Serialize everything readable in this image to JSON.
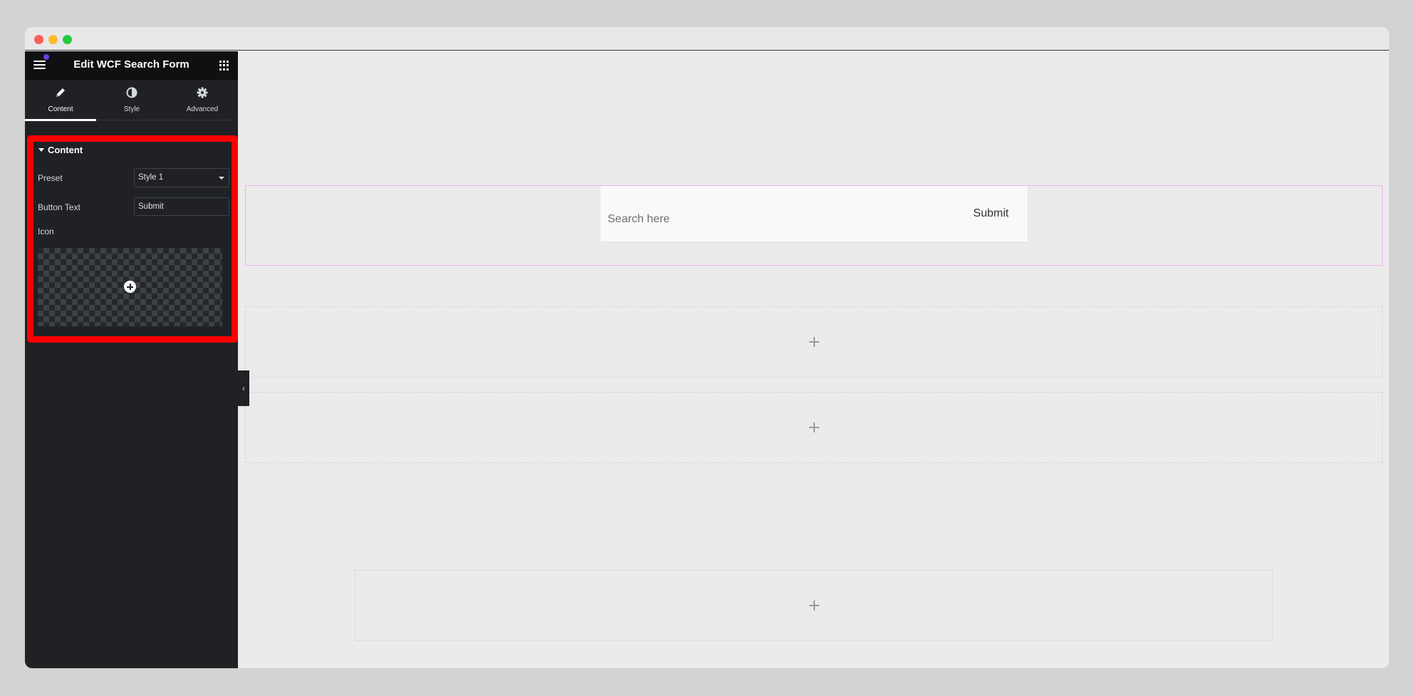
{
  "window": {
    "controls": [
      "close",
      "minimize",
      "maximize"
    ]
  },
  "sidebar": {
    "title": "Edit WCF Search Form",
    "menu_icon": "hamburger-icon",
    "apps_icon": "grid-icon",
    "notification": true,
    "tabs": [
      {
        "label": "Content",
        "icon": "pencil-icon",
        "active": true
      },
      {
        "label": "Style",
        "icon": "half-circle-icon",
        "active": false
      },
      {
        "label": "Advanced",
        "icon": "gear-icon",
        "active": false
      }
    ],
    "section": {
      "title": "Content",
      "controls": {
        "preset": {
          "label": "Preset",
          "value": "Style 1"
        },
        "button_text": {
          "label": "Button Text",
          "value": "Submit"
        },
        "icon": {
          "label": "Icon",
          "picker_icon": "plus-circle-icon"
        }
      }
    },
    "highlight_color": "#ff0000"
  },
  "canvas": {
    "search_form": {
      "placeholder": "Search here",
      "submit_label": "Submit"
    },
    "selected_outline_color": "#f0b0ec",
    "empty_sections": [
      {
        "add_icon": "plus-icon"
      },
      {
        "add_icon": "plus-icon"
      },
      {
        "add_icon": "plus-icon"
      }
    ]
  },
  "collapse_icon": "chevron-left-icon"
}
